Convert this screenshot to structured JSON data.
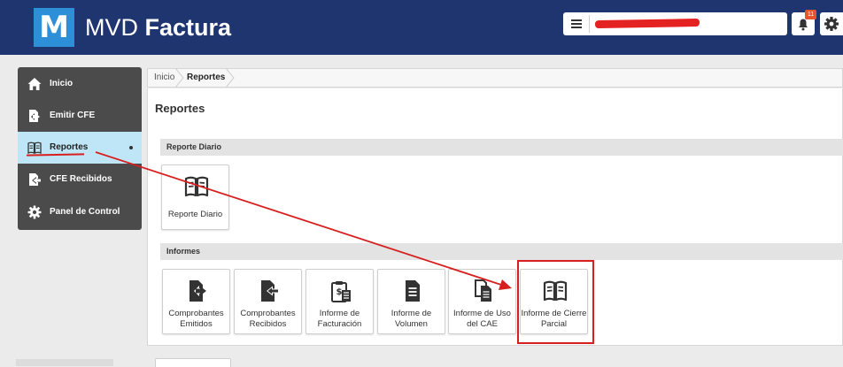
{
  "header": {
    "logo_letter": "M",
    "brand_light": "MVD ",
    "brand_bold": "Factura",
    "notification_count": "11",
    "colors": {
      "header_bg": "#1f3570",
      "logo_bg": "#2d8fd8",
      "badge": "#e8532c"
    }
  },
  "sidebar": {
    "items": [
      {
        "label": "Inicio",
        "icon": "home-icon"
      },
      {
        "label": "Emitir CFE",
        "icon": "document-send-icon"
      },
      {
        "label": "Reportes",
        "icon": "open-book-icon",
        "active": true
      },
      {
        "label": "CFE Recibidos",
        "icon": "document-receive-icon"
      },
      {
        "label": "Panel de Control",
        "icon": "gear-icon"
      }
    ]
  },
  "breadcrumb": {
    "home": "Inicio",
    "current": "Reportes"
  },
  "page_title": "Reportes",
  "sections": {
    "diario": {
      "title": "Reporte Diario",
      "tiles": [
        {
          "label": "Reporte Diario",
          "icon": "open-book-icon"
        }
      ]
    },
    "informes": {
      "title": "Informes",
      "tiles": [
        {
          "label": "Comprobantes Emitidos",
          "icon": "document-send-icon"
        },
        {
          "label": "Comprobantes Recibidos",
          "icon": "document-receive-icon"
        },
        {
          "label": "Informe de Facturación",
          "icon": "invoice-clipboard-icon"
        },
        {
          "label": "Informe de Volumen",
          "icon": "document-lines-icon"
        },
        {
          "label": "Informe de Uso del CAE",
          "icon": "documents-copy-icon"
        },
        {
          "label": "Informe de Cierre Parcial",
          "icon": "open-book-icon",
          "highlighted": true
        }
      ]
    }
  },
  "annotation_color": "#d81f1f"
}
